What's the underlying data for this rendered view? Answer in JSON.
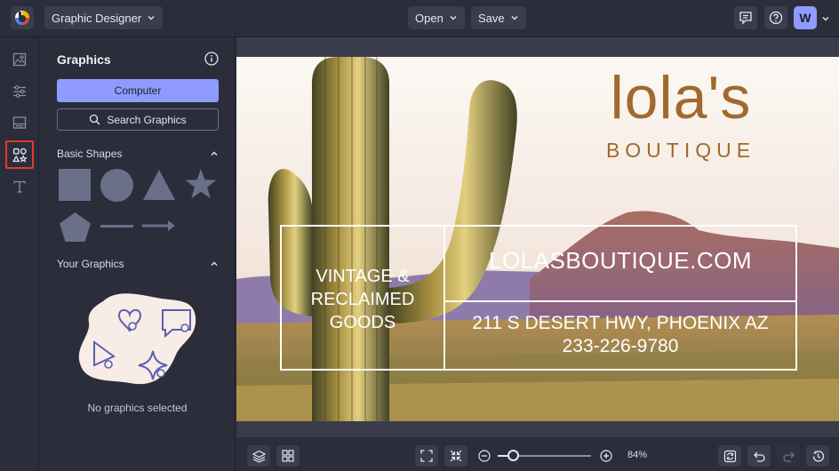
{
  "topbar": {
    "project_name": "Graphic Designer",
    "open_label": "Open",
    "save_label": "Save",
    "avatar_initial": "W"
  },
  "rail": {
    "items": [
      {
        "icon": "image-icon"
      },
      {
        "icon": "sliders-icon"
      },
      {
        "icon": "layout-icon"
      },
      {
        "icon": "graphics-icon",
        "active": true
      },
      {
        "icon": "text-icon"
      }
    ]
  },
  "panel": {
    "title": "Graphics",
    "computer_label": "Computer",
    "search_label": "Search Graphics",
    "basic_shapes_label": "Basic Shapes",
    "your_graphics_label": "Your Graphics",
    "empty_label": "No graphics selected"
  },
  "canvas": {
    "brand_main": "lola's",
    "brand_sub": "BOUTIQUE",
    "tagline_lines": [
      "VINTAGE &",
      "RECLAIMED",
      "GOODS"
    ],
    "website": "LOLASBOUTIQUE.COM",
    "address": "211 S DESERT HWY, PHOENIX AZ",
    "phone": "233-226-9780"
  },
  "bottombar": {
    "zoom_label": "84%",
    "zoom_level": 0.16
  },
  "colors": {
    "accent": "#8f9bff",
    "highlight": "#e1392b",
    "brand": "#a06a2c"
  }
}
